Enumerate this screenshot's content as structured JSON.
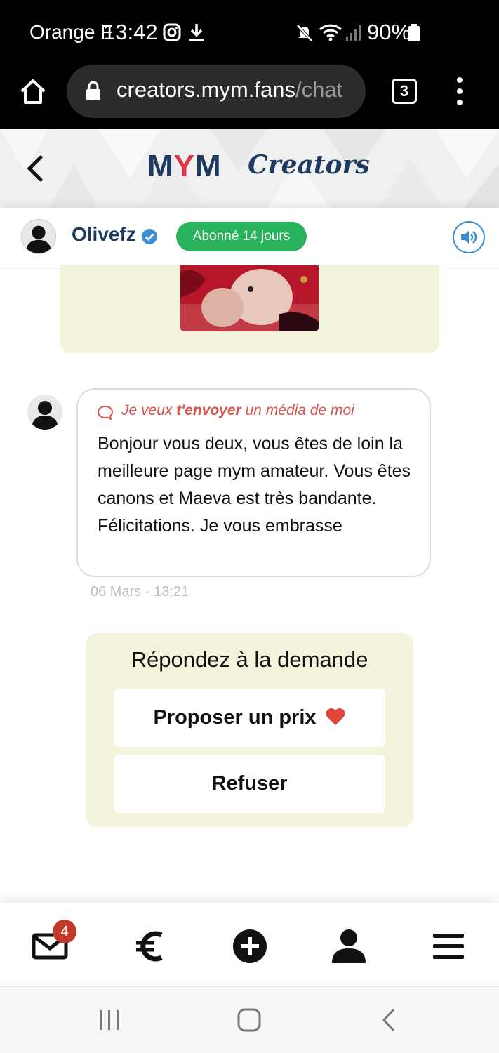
{
  "status_bar": {
    "carrier": "Orange F",
    "time": "13:42",
    "battery": "90%"
  },
  "browser": {
    "url_host": "creators.mym.fans",
    "url_path": "/chat",
    "tab_count": "3"
  },
  "site": {
    "logo_prefix": "M",
    "logo_accent": "Y",
    "logo_suffix": "M",
    "logo_tagline": "Creators"
  },
  "chat_header": {
    "username": "Olivefz",
    "subscription_badge": "Abonné 14 jours"
  },
  "message": {
    "request_prefix": "Je veux ",
    "request_bold": "t'envoyer",
    "request_suffix": " un média de moi",
    "text": "Bonjour vous deux, vous êtes de loin la meilleure page mym amateur. Vous êtes canons et Maeva est très bandante. Félicitations. Je vous embrasse",
    "timestamp": "06 Mars - 13:21"
  },
  "reply": {
    "title": "Répondez à la demande",
    "propose_label": "Proposer un prix",
    "refuse_label": "Refuser"
  },
  "bottom_nav": {
    "messages_badge": "4",
    "items": [
      "messages-icon",
      "euro-icon",
      "add-icon",
      "user-icon",
      "menu-icon"
    ]
  },
  "colors": {
    "brand_navy": "#1e3a5f",
    "brand_red": "#e0354a",
    "badge_green": "#29b35d",
    "card_cream": "#f4f4dc",
    "request_red": "#d9534f",
    "notification_red": "#c0392b"
  }
}
